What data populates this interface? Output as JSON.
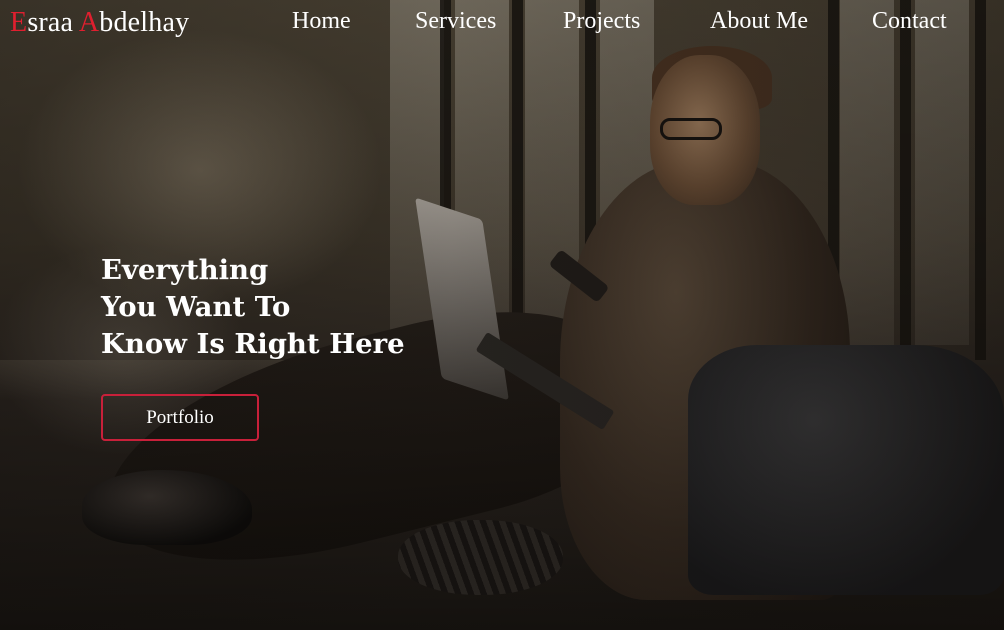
{
  "brand": {
    "first_initial": "E",
    "first_rest": "sraa ",
    "last_initial": "A",
    "last_rest": "bdelhay"
  },
  "nav": {
    "items": [
      "Home",
      "Services",
      "Projects",
      "About Me",
      "Contact"
    ]
  },
  "hero": {
    "title_lines": [
      "Everything",
      "You Want To",
      "Know Is Right Here"
    ],
    "cta_label": "Portfolio"
  },
  "colors": {
    "accent": "#e01f2f",
    "button_border": "#c8203a",
    "text": "#ffffff"
  },
  "background": {
    "icon": "man-with-laptop-photo"
  }
}
